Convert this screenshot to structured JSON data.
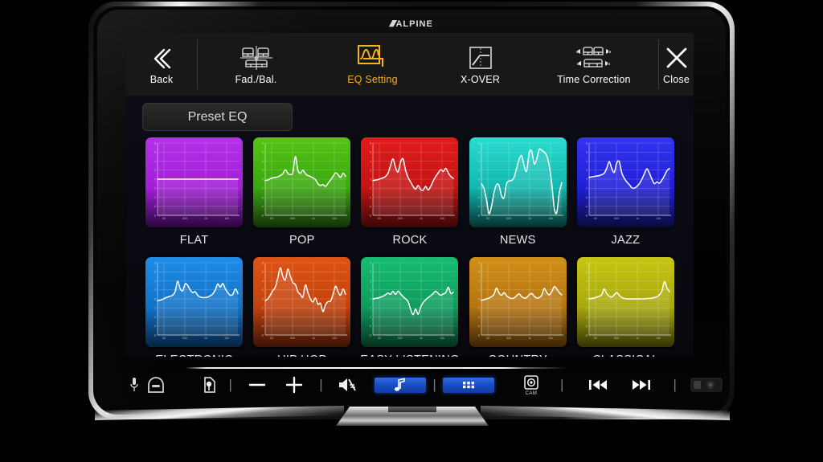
{
  "device": {
    "brand": "ALPINE",
    "brand_slashes": "/////"
  },
  "toolbar": {
    "items": [
      {
        "id": "back",
        "label": "Back",
        "icon": "chevron-double-left-icon",
        "active": false
      },
      {
        "id": "fad_bal",
        "label": "Fad./Bal.",
        "icon": "seat-balance-icon",
        "active": false
      },
      {
        "id": "eq_setting",
        "label": "EQ Setting",
        "icon": "eq-curve-icon",
        "active": true
      },
      {
        "id": "x_over",
        "label": "X-OVER",
        "icon": "crossover-slope-icon",
        "active": false
      },
      {
        "id": "time_correction",
        "label": "Time Correction",
        "icon": "speaker-time-icon",
        "active": false
      },
      {
        "id": "close",
        "label": "Close",
        "icon": "close-x-icon",
        "active": false
      }
    ]
  },
  "main": {
    "preset_button_label": "Preset EQ",
    "presets": [
      {
        "name": "FLAT",
        "accent": "#a21fd6",
        "top_color": "#b331ea",
        "bottom_color": "#2a0740",
        "curve": [
          0,
          0,
          0,
          0,
          0,
          0,
          0,
          0,
          0,
          0,
          0,
          0,
          0,
          0,
          0,
          0,
          0,
          0,
          0,
          0,
          0,
          0,
          0,
          0,
          0,
          0,
          0,
          0,
          0,
          0,
          0,
          0,
          0
        ]
      },
      {
        "name": "POP",
        "accent": "#3aa80f",
        "top_color": "#55c414",
        "bottom_color": "#14300a",
        "curve": [
          -0.3,
          -0.2,
          0.1,
          0.3,
          0.4,
          0.5,
          0.8,
          1.2,
          2.1,
          1.3,
          1.0,
          1.5,
          5.0,
          2.0,
          1.3,
          2.0,
          1.2,
          0.8,
          0.6,
          0.3,
          -0.1,
          -1.0,
          -1.4,
          -1.2,
          -1.6,
          -0.9,
          -0.2,
          0.6,
          1.4,
          1.0,
          0.4,
          1.3,
          0.6
        ]
      },
      {
        "name": "ROCK",
        "accent": "#c51414",
        "top_color": "#e01b1b",
        "bottom_color": "#3a0707",
        "curve": [
          -0.3,
          -0.2,
          -0.1,
          0.1,
          0.3,
          0.6,
          1.3,
          3.0,
          4.5,
          2.6,
          1.6,
          3.8,
          4.5,
          2.0,
          0.4,
          -0.6,
          -1.6,
          -2.2,
          -1.4,
          -2.3,
          -2.4,
          -1.6,
          -2.4,
          -1.6,
          -0.4,
          0.6,
          1.4,
          2.1,
          1.7,
          2.4,
          1.4,
          0.6,
          0.2
        ]
      },
      {
        "name": "NEWS",
        "accent": "#12b8ae",
        "top_color": "#2adcd0",
        "bottom_color": "#07312f",
        "curve": [
          -1.0,
          -2.0,
          -4.5,
          -7.6,
          -6.0,
          -3.0,
          -1.2,
          -1.4,
          -3.6,
          -4.1,
          -1.0,
          -0.4,
          -0.3,
          0.4,
          2.4,
          4.4,
          5.2,
          3.0,
          1.8,
          5.8,
          6.2,
          3.4,
          4.4,
          6.6,
          6.4,
          6.0,
          5.2,
          3.0,
          -1.0,
          -6.4,
          -7.4,
          -3.0,
          -0.8
        ]
      },
      {
        "name": "JAZZ",
        "accent": "#2020d8",
        "top_color": "#3434f0",
        "bottom_color": "#0a0a3a",
        "curve": [
          0.4,
          0.5,
          0.6,
          0.7,
          0.8,
          1.0,
          1.3,
          2.4,
          3.9,
          2.4,
          1.5,
          3.6,
          3.9,
          1.4,
          0.2,
          -0.6,
          -1.2,
          -1.9,
          -2.0,
          -1.6,
          -1.0,
          0.0,
          1.2,
          2.3,
          1.3,
          0.0,
          -1.0,
          -0.6,
          -0.9,
          -0.2,
          0.8,
          1.9,
          2.4
        ]
      },
      {
        "name": "ELECTRONIC",
        "accent": "#1272c8",
        "top_color": "#1f8de8",
        "bottom_color": "#06233f",
        "curve": [
          -0.4,
          -0.3,
          -0.1,
          0.2,
          0.4,
          0.6,
          0.8,
          1.6,
          3.9,
          2.3,
          1.8,
          3.3,
          3.0,
          2.0,
          1.4,
          1.6,
          0.8,
          0.4,
          0.3,
          0.3,
          0.4,
          0.7,
          1.1,
          2.0,
          3.3,
          2.6,
          3.4,
          2.2,
          1.4,
          0.8,
          1.0,
          2.2,
          1.2
        ]
      },
      {
        "name": "HIP HOP",
        "accent": "#c2420c",
        "top_color": "#e05415",
        "bottom_color": "#3a1205",
        "curve": [
          -0.4,
          0.0,
          0.8,
          1.8,
          2.6,
          4.6,
          6.9,
          5.0,
          4.2,
          6.6,
          5.0,
          3.6,
          3.2,
          1.6,
          1.0,
          0.4,
          3.1,
          1.4,
          0.0,
          -0.7,
          0.2,
          -1.2,
          -1.0,
          -2.8,
          -1.3,
          -0.6,
          -0.5,
          1.0,
          2.8,
          1.6,
          0.8,
          2.2,
          1.0
        ]
      },
      {
        "name": "EASY LISTENING",
        "accent": "#0f9c5e",
        "top_color": "#16bd71",
        "bottom_color": "#05301d",
        "curve": [
          0.0,
          0.1,
          0.2,
          0.4,
          0.6,
          0.9,
          1.3,
          1.0,
          1.7,
          1.0,
          1.7,
          1.1,
          0.5,
          0.0,
          -0.6,
          -2.3,
          -3.5,
          -2.2,
          -3.4,
          -1.8,
          -0.8,
          -0.2,
          0.3,
          0.7,
          1.2,
          1.7,
          1.2,
          0.8,
          1.1,
          1.4,
          2.6,
          1.2,
          1.5
        ]
      },
      {
        "name": "COUNTRY",
        "accent": "#b57512",
        "top_color": "#d18f18",
        "bottom_color": "#3a2405",
        "curve": [
          -0.3,
          -0.2,
          0.0,
          0.2,
          0.5,
          1.0,
          2.4,
          1.3,
          0.8,
          1.4,
          0.7,
          0.3,
          0.1,
          0.2,
          0.7,
          1.1,
          0.5,
          0.2,
          0.3,
          0.9,
          1.2,
          0.6,
          0.2,
          0.3,
          0.8,
          2.3,
          1.4,
          0.9,
          1.6,
          2.7,
          2.2,
          1.4,
          0.9
        ]
      },
      {
        "name": "CLASSICAL",
        "accent": "#a8a80f",
        "top_color": "#c6c614",
        "bottom_color": "#333305",
        "curve": [
          0.0,
          0.1,
          0.2,
          0.4,
          0.6,
          0.9,
          2.2,
          1.2,
          0.6,
          0.4,
          0.9,
          1.4,
          0.8,
          0.3,
          0.1,
          0.0,
          0.0,
          0.0,
          0.0,
          0.0,
          0.0,
          0.0,
          0.0,
          0.1,
          0.1,
          0.2,
          0.3,
          0.5,
          0.9,
          1.8,
          3.8,
          2.4,
          1.6
        ]
      }
    ],
    "graph": {
      "y_ticks": [
        "8",
        "6",
        "4",
        "2",
        "0",
        "-2",
        "-4",
        "-6",
        "-8"
      ],
      "x_ticks": [
        "50",
        "500",
        "1k",
        "10k"
      ],
      "y_min": -8,
      "y_max": 8
    }
  },
  "hardware_bar": {
    "buttons": [
      {
        "id": "mic",
        "icon": "microphone-icon",
        "label": ""
      },
      {
        "id": "hands_free",
        "icon": "hands-free-icon",
        "label": ""
      },
      {
        "id": "voice",
        "icon": "voice-tag-icon",
        "label": ""
      },
      {
        "id": "volume_down",
        "icon": "minus-icon",
        "label": "−"
      },
      {
        "id": "volume_up",
        "icon": "plus-icon",
        "label": "+"
      },
      {
        "id": "mute",
        "icon": "mute-icon",
        "label": ""
      },
      {
        "id": "audio",
        "icon": "music-note-icon",
        "label": ""
      },
      {
        "id": "apps",
        "icon": "apps-grid-icon",
        "label": ""
      },
      {
        "id": "camera",
        "icon": "camera-icon",
        "label": "CAM"
      },
      {
        "id": "prev_track",
        "icon": "previous-track-icon",
        "label": ""
      },
      {
        "id": "next_track",
        "icon": "next-track-icon",
        "label": ""
      },
      {
        "id": "ir_sensor",
        "icon": "ir-sensor-icon",
        "label": ""
      }
    ]
  }
}
